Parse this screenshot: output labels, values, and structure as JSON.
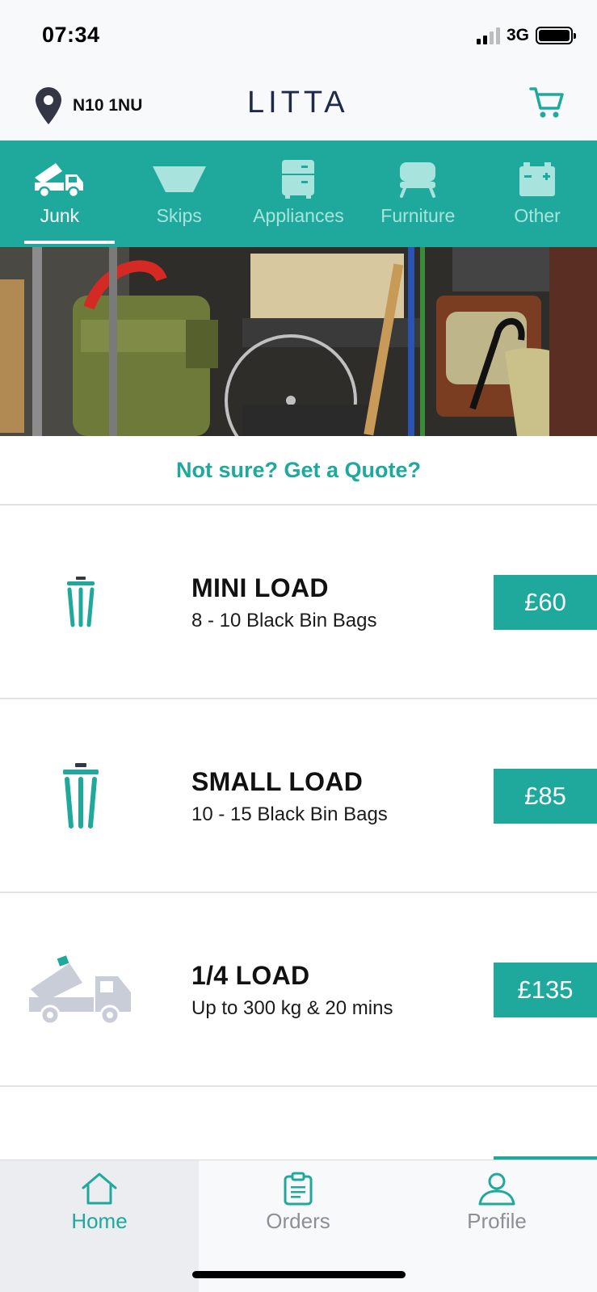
{
  "status_bar": {
    "time": "07:34",
    "network": "3G",
    "icons": [
      "signal-icon",
      "battery-icon"
    ]
  },
  "header": {
    "location": "N10 1NU",
    "brand": "LITTA",
    "icons": [
      "location-pin-icon",
      "cart-icon"
    ]
  },
  "colors": {
    "accent": "#1fa99c",
    "brand_text": "#1f2a4a",
    "tab_inactive_text": "#a8e3dd",
    "nav_inactive": "#8d8f93"
  },
  "tabs": [
    {
      "label": "Junk",
      "icon": "truck-icon",
      "active": true
    },
    {
      "label": "Skips",
      "icon": "skip-icon",
      "active": false
    },
    {
      "label": "Appliances",
      "icon": "appliance-icon",
      "active": false
    },
    {
      "label": "Furniture",
      "icon": "sofa-icon",
      "active": false
    },
    {
      "label": "Other",
      "icon": "battery-box-icon",
      "active": false
    }
  ],
  "quote_link": "Not sure? Get a Quote?",
  "loads": [
    {
      "title": "MINI LOAD",
      "subtitle": "8 - 10 Black Bin Bags",
      "price": "£60",
      "icon": "bin-icon"
    },
    {
      "title": "SMALL LOAD",
      "subtitle": "10 - 15 Black Bin Bags",
      "price": "£85",
      "icon": "bin-icon"
    },
    {
      "title": "1/4 LOAD",
      "subtitle": "Up to 300 kg & 20 mins",
      "price": "£135",
      "icon": "tipper-truck-icon"
    }
  ],
  "bottom_nav": [
    {
      "label": "Home",
      "icon": "home-icon",
      "active": true
    },
    {
      "label": "Orders",
      "icon": "clipboard-icon",
      "active": false
    },
    {
      "label": "Profile",
      "icon": "user-icon",
      "active": false
    }
  ]
}
